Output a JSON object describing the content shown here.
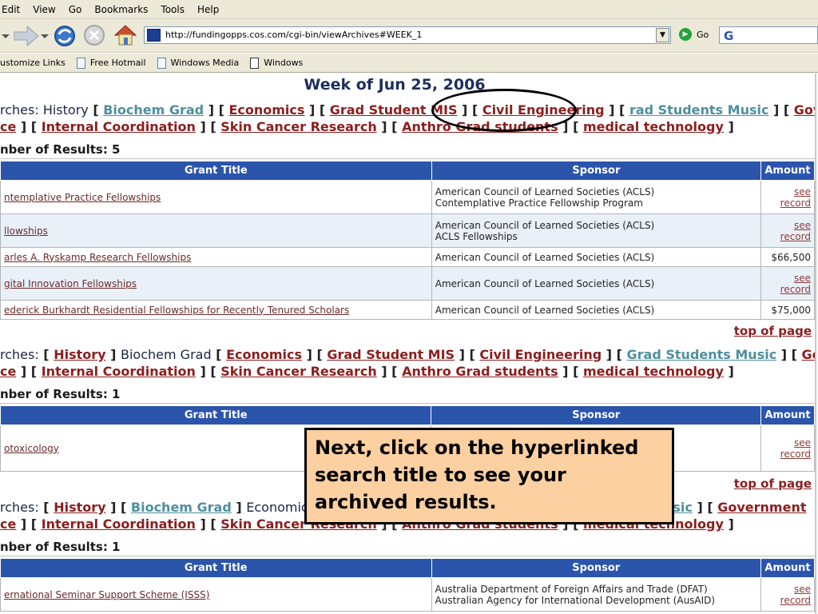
{
  "menu": [
    "Edit",
    "View",
    "Go",
    "Bookmarks",
    "Tools",
    "Help"
  ],
  "url": "http://fundingopps.cos.com/cgi-bin/viewArchives#WEEK_1",
  "go_label": "Go",
  "links_bar": [
    "ustomize Links",
    "Free Hotmail",
    "Windows Media",
    "Windows"
  ],
  "week_title": "Week of Jun 25, 2006",
  "sections": [
    {
      "line1_prefix": "rches: History",
      "searches_line2": [
        "ce",
        "Internal Coordination",
        "Skin Cancer Research",
        "Anthro Grad students",
        "medical technology"
      ],
      "results": "nber of Results: 5",
      "rows": [
        {
          "title": "ntemplative Practice Fellowships",
          "sponsor1": "American Council of Learned Societies (ACLS)",
          "sponsor2": "Contemplative Practice Fellowship Program",
          "amount1": "see",
          "amount2": "record"
        },
        {
          "title": "llowships",
          "sponsor1": "American Council of Learned Societies (ACLS)",
          "sponsor2": "ACLS Fellowships",
          "amount1": "see",
          "amount2": "record"
        },
        {
          "title": "arles A. Ryskamp Research Fellowships",
          "sponsor1": "American Council of Learned Societies (ACLS)",
          "sponsor2": "",
          "amount1": "$66,500",
          "amount2": ""
        },
        {
          "title": "gital Innovation Fellowships",
          "sponsor1": "American Council of Learned Societies (ACLS)",
          "sponsor2": "",
          "amount1": "see",
          "amount2": "record"
        },
        {
          "title": "ederick Burkhardt Residential Fellowships for Recently Tenured Scholars",
          "sponsor1": "American Council of Learned Societies (ACLS)",
          "sponsor2": "",
          "amount1": "$75,000",
          "amount2": ""
        }
      ]
    },
    {
      "line1_prefix": "rches:",
      "results": "nber of Results: 1",
      "rows": [
        {
          "title": "otoxicology",
          "sponsor1": "",
          "sponsor2": "",
          "amount1": "see",
          "amount2": "record"
        }
      ]
    },
    {
      "line1_prefix": "rches:",
      "results": "nber of Results: 1",
      "rows": [
        {
          "title": "ernational Seminar Support Scheme (ISSS)",
          "sponsor1": "Australia Department of Foreign Affairs and Trade (DFAT)",
          "sponsor2": "Australian Agency for International Development (AusAID)",
          "amount1": "see",
          "amount2": "record"
        }
      ]
    }
  ],
  "search_names": {
    "history": "History",
    "biochem": "Biochem Grad",
    "economics": "Economics",
    "grad_mis": "Grad Student MIS",
    "civil": "Civil Engineering",
    "music": "Grad Students Music",
    "government": "Government",
    "music_partial": "rad Students Music",
    "music_tail": "usic"
  },
  "table_headers": {
    "title": "Grant Title",
    "sponsor": "Sponsor",
    "amount": "Amount"
  },
  "top_of_page": "top of page",
  "callout_text": "Next, click on the hyperlinked search title to see your archived results."
}
